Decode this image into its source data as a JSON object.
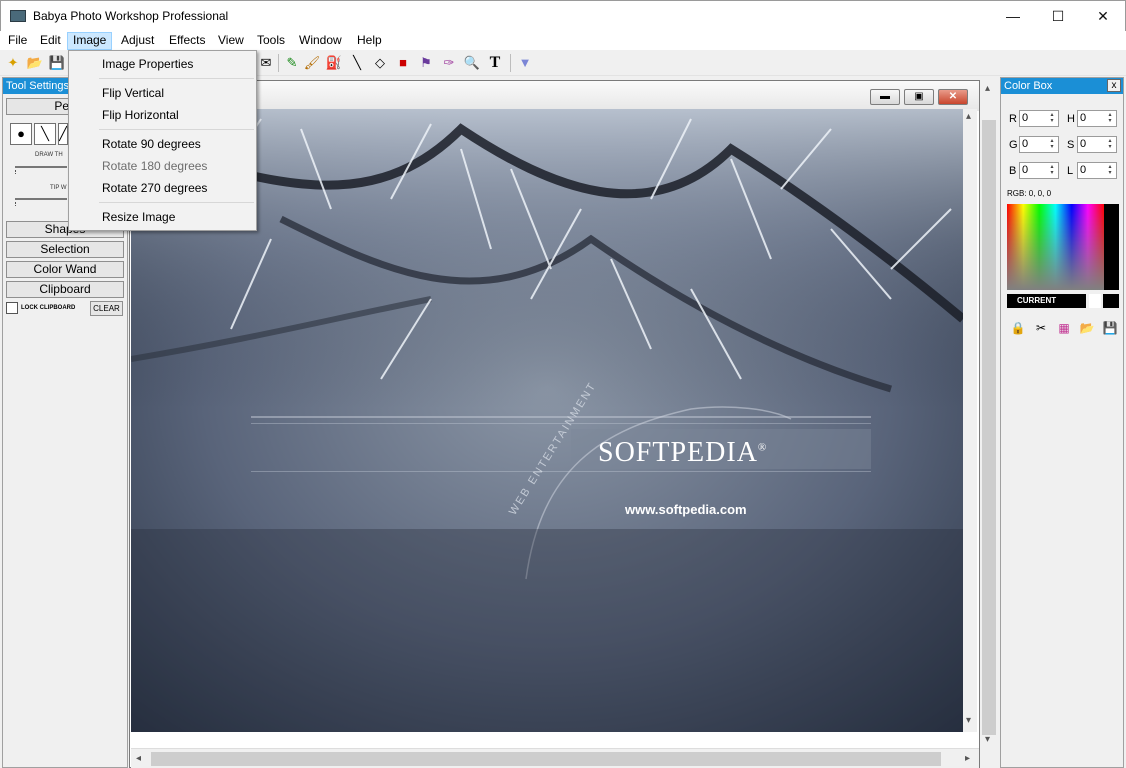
{
  "window": {
    "title": "Babya Photo Workshop Professional",
    "minimize": "—",
    "maximize": "☐",
    "close": "✕"
  },
  "menubar": {
    "items": [
      "File",
      "Edit",
      "Image",
      "Adjust",
      "Effects",
      "View",
      "Tools",
      "Window",
      "Help"
    ],
    "active": "Image"
  },
  "image_menu": {
    "items": [
      {
        "label": "Image Properties",
        "enabled": true
      },
      {
        "label": "Flip Vertical",
        "enabled": true
      },
      {
        "label": "Flip Horizontal",
        "enabled": true
      },
      {
        "label": "Rotate 90 degrees",
        "enabled": true
      },
      {
        "label": "Rotate 180 degrees",
        "enabled": false
      },
      {
        "label": "Rotate 270 degrees",
        "enabled": true
      },
      {
        "label": "Resize Image",
        "enabled": true
      }
    ]
  },
  "tool_settings": {
    "title": "Tool Settings",
    "close": "x",
    "pen_button": "Pen",
    "draw_label": "DRAW TH",
    "tip_label": "TIP W",
    "shapes_button": "Shapes",
    "selection_button": "Selection",
    "color_wand_button": "Color Wand",
    "clipboard_button": "Clipboard",
    "lock_clipboard_label": "LOCK CLIPBOARD",
    "clear_button": "CLEAR"
  },
  "document": {
    "title_fragment": "g"
  },
  "color_box": {
    "title": "Color Box",
    "close": "x",
    "fields": [
      {
        "label": "R",
        "value": "0"
      },
      {
        "label": "H",
        "value": "0"
      },
      {
        "label": "G",
        "value": "0"
      },
      {
        "label": "S",
        "value": "0"
      },
      {
        "label": "B",
        "value": "0"
      },
      {
        "label": "L",
        "value": "0"
      }
    ],
    "rgb_text": "RGB: 0, 0, 0",
    "current_label": "CURRENT"
  },
  "photo": {
    "brand": "SOFTPEDIA",
    "registered": "®",
    "url": "www.softpedia.com",
    "arc_text": "WEB  ENTERTAINMENT"
  }
}
